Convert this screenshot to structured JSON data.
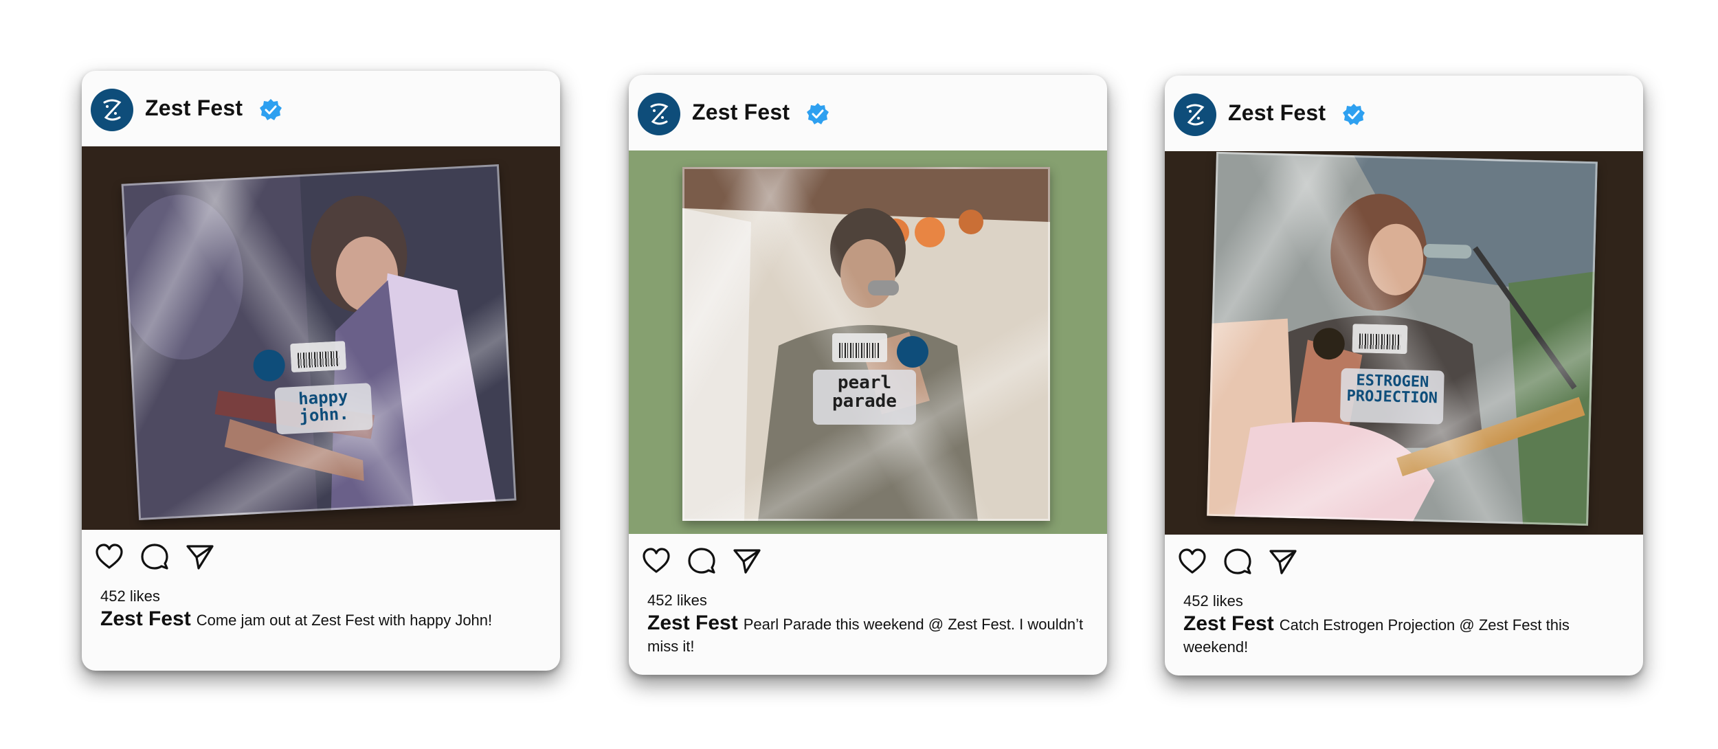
{
  "posts": [
    {
      "account": "Zest Fest",
      "likes": "452 likes",
      "caption_user": "Zest Fest",
      "caption_text": "Come jam out at Zest Fest with happy John!",
      "band_sticker": "happy John.",
      "background_color": "#30231a"
    },
    {
      "account": "Zest Fest",
      "likes": "452 likes",
      "caption_user": "Zest Fest",
      "caption_text": "Pearl Parade this weekend @ Zest Fest. I wouldn’t miss it!",
      "band_sticker": "PEARL PARADE",
      "background_color": "#86a070"
    },
    {
      "account": "Zest Fest",
      "likes": "452 likes",
      "caption_user": "Zest Fest",
      "caption_text": "Catch Estrogen Projection @ Zest Fest this weekend!",
      "band_sticker": "ESTROGEN PROJECTION",
      "background_color": "#30241a"
    }
  ],
  "icons": {
    "avatar": "zest-fest-logo-icon",
    "verified": "verified-badge-icon",
    "like": "heart-icon",
    "comment": "comment-icon",
    "share": "send-icon"
  },
  "colors": {
    "verified_blue": "#2ea0f0",
    "brand_blue": "#0e4d7a"
  }
}
